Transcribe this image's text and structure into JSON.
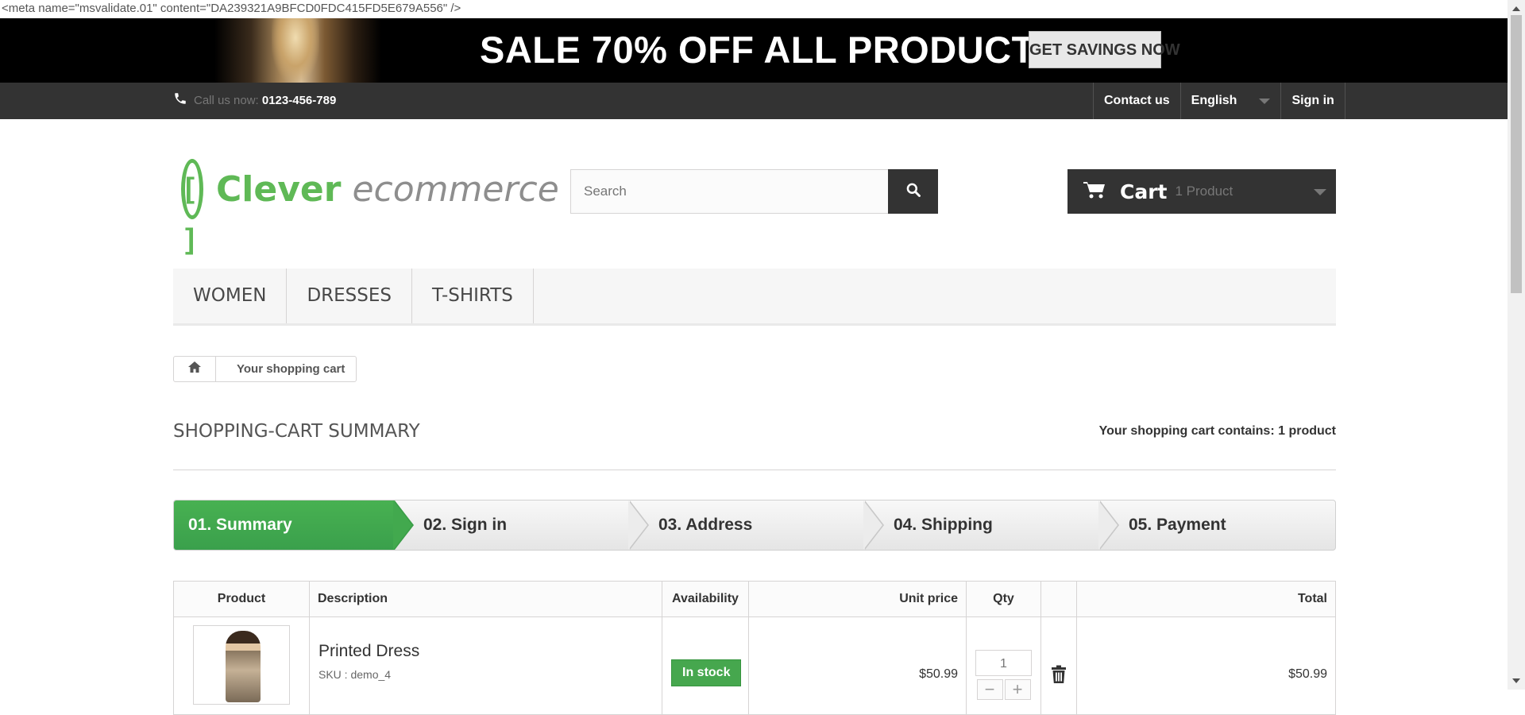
{
  "meta_line": "<meta name=\"msvalidate.01\" content=\"DA239321A9BFCD0FDC415FD5E679A556\" />",
  "promo": {
    "text": "SALE 70% OFF ALL PRODUCTS",
    "button": "GET SAVINGS NOW"
  },
  "topbar": {
    "call_label": "Call us now:",
    "phone": "0123-456-789",
    "contact": "Contact us",
    "language": "English",
    "signin": "Sign in"
  },
  "logo": {
    "mark": "[ ]",
    "brand_primary": "Clever",
    "brand_secondary": "ecommerce"
  },
  "search": {
    "placeholder": "Search"
  },
  "cart": {
    "label": "Cart",
    "qty_text": "1 Product"
  },
  "menu": [
    "WOMEN",
    "DRESSES",
    "T-SHIRTS"
  ],
  "breadcrumb": {
    "current": "Your shopping cart"
  },
  "summary": {
    "title": "SHOPPING-CART SUMMARY",
    "count_text": "Your shopping cart contains: 1 product"
  },
  "steps": [
    "01. Summary",
    "02. Sign in",
    "03. Address",
    "04. Shipping",
    "05. Payment"
  ],
  "table": {
    "headers": [
      "Product",
      "Description",
      "Availability",
      "Unit price",
      "Qty",
      "",
      "Total"
    ],
    "row": {
      "name": "Printed Dress",
      "sku": "SKU : demo_4",
      "availability": "In stock",
      "unit_price": "$50.99",
      "qty": "1",
      "minus": "−",
      "plus": "+",
      "total": "$50.99"
    }
  },
  "colors": {
    "accent_green": "#46a74e",
    "dark": "#333333"
  },
  "icons": {
    "phone": "phone-icon",
    "search": "search-icon",
    "cart": "cart-icon",
    "home": "home-icon",
    "trash": "trash-icon"
  }
}
